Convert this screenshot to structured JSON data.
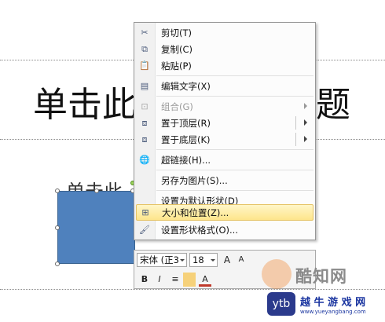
{
  "slide": {
    "title_left": "单击此",
    "title_right": "题",
    "subtitle_peek": "单击此"
  },
  "context_menu": {
    "items": [
      {
        "label": "剪切(T)",
        "icon": "scissors-icon",
        "glyph": "✂"
      },
      {
        "label": "复制(C)",
        "icon": "copy-icon",
        "glyph": "⧉"
      },
      {
        "label": "粘贴(P)",
        "icon": "paste-icon",
        "glyph": "📋"
      },
      {
        "label": "编辑文字(X)",
        "icon": "edit-text-icon",
        "glyph": "▤"
      },
      {
        "label": "组合(G)",
        "icon": "group-icon",
        "glyph": "⊡"
      },
      {
        "label": "置于顶层(R)",
        "icon": "bring-to-front-icon",
        "glyph": "⧈"
      },
      {
        "label": "置于底层(K)",
        "icon": "send-to-back-icon",
        "glyph": "⧈"
      },
      {
        "label": "超链接(H)...",
        "icon": "hyperlink-icon",
        "glyph": "🌐"
      },
      {
        "label": "另存为图片(S)...",
        "icon": "",
        "glyph": ""
      },
      {
        "label": "设置为默认形状(D)",
        "icon": "",
        "glyph": ""
      },
      {
        "label": "大小和位置(Z)...",
        "icon": "size-position-icon",
        "glyph": "⊞"
      },
      {
        "label": "设置形状格式(O)...",
        "icon": "format-shape-icon",
        "glyph": "🖌"
      }
    ]
  },
  "mini_toolbar": {
    "font_name": "宋体 (正3",
    "font_size": "18",
    "grow_font": "A",
    "shrink_font": "A",
    "bold": "B",
    "italic": "I",
    "align": "≡",
    "font_color": "A"
  },
  "watermark": {
    "brand": "酷知网",
    "badge": "ytb",
    "site_cn": "越 牛 游 戏 网",
    "url": "www.yueyangbang.com"
  },
  "colors": {
    "shape_fill": "#4f81bd",
    "menu_highlight": "#fde58b"
  }
}
